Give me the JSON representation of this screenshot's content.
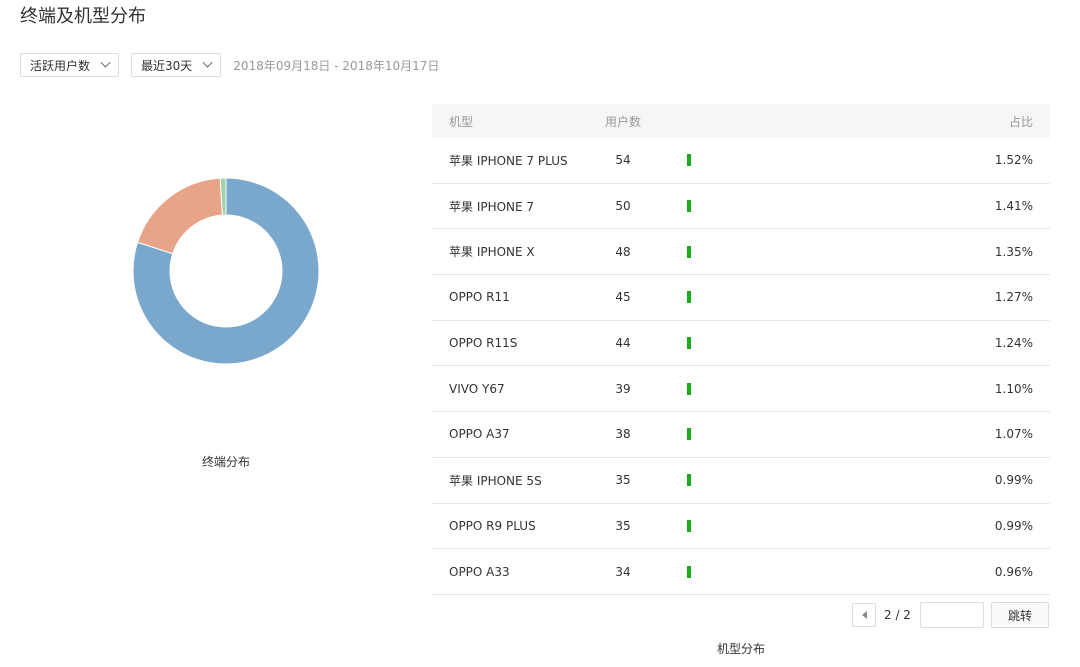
{
  "page": {
    "title": "终端及机型分布"
  },
  "filters": {
    "metric": "活跃用户数",
    "range": "最近30天",
    "date_range": "2018年09月18日 - 2018年10月17日"
  },
  "donut": {
    "caption": "终端分布",
    "colors": [
      "#7aa8cd",
      "#e8a488",
      "#9fd2a9"
    ],
    "values": [
      80,
      19,
      1
    ]
  },
  "table": {
    "headers": {
      "model": "机型",
      "users": "用户数",
      "share": "占比"
    },
    "bar_color": "#1aad19",
    "rows": [
      {
        "model": "苹果 IPHONE 7 PLUS",
        "users": "54",
        "share": "1.52%"
      },
      {
        "model": "苹果 IPHONE 7",
        "users": "50",
        "share": "1.41%"
      },
      {
        "model": "苹果 IPHONE X",
        "users": "48",
        "share": "1.35%"
      },
      {
        "model": "OPPO R11",
        "users": "45",
        "share": "1.27%"
      },
      {
        "model": "OPPO R11S",
        "users": "44",
        "share": "1.24%"
      },
      {
        "model": "VIVO Y67",
        "users": "39",
        "share": "1.10%"
      },
      {
        "model": "OPPO A37",
        "users": "38",
        "share": "1.07%"
      },
      {
        "model": "苹果 IPHONE 5S",
        "users": "35",
        "share": "0.99%"
      },
      {
        "model": "OPPO R9 PLUS",
        "users": "35",
        "share": "0.99%"
      },
      {
        "model": "OPPO A33",
        "users": "34",
        "share": "0.96%"
      }
    ],
    "caption": "机型分布"
  },
  "pager": {
    "page_label": "2 / 2",
    "input_value": "",
    "jump_label": "跳转"
  }
}
